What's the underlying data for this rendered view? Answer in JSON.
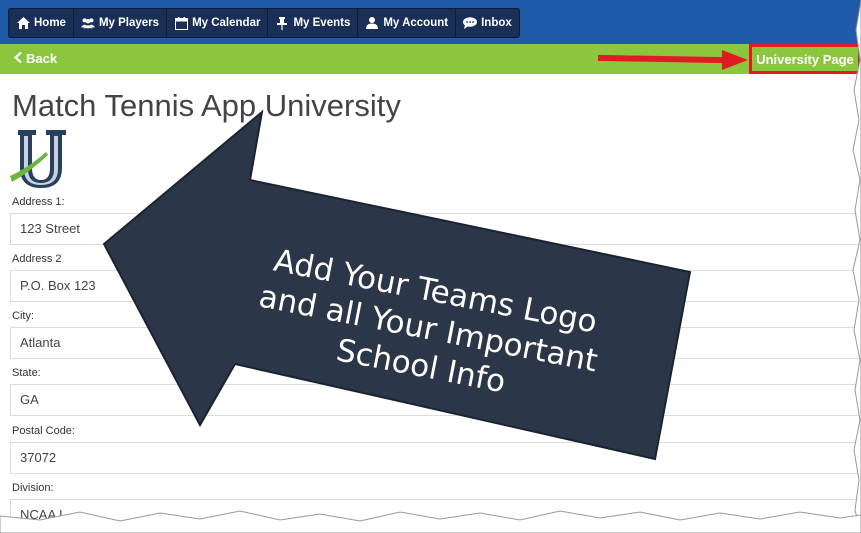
{
  "nav": {
    "items": [
      {
        "label": "Home",
        "icon": "home-icon"
      },
      {
        "label": "My Players",
        "icon": "users-icon"
      },
      {
        "label": "My Calendar",
        "icon": "calendar-icon"
      },
      {
        "label": "My Events",
        "icon": "pin-icon"
      },
      {
        "label": "My Account",
        "icon": "user-icon"
      },
      {
        "label": "Inbox",
        "icon": "chat-icon"
      }
    ]
  },
  "subbar": {
    "back_label": "Back",
    "university_button": "University Page"
  },
  "page": {
    "title": "Match Tennis App University",
    "logo_icon": "university-u-logo"
  },
  "fields": [
    {
      "label": "Address 1:",
      "value": "123 Street"
    },
    {
      "label": "Address 2",
      "value": "P.O. Box 123"
    },
    {
      "label": "City:",
      "value": "Atlanta"
    },
    {
      "label": "State:",
      "value": "GA"
    },
    {
      "label": "Postal Code:",
      "value": "37072"
    },
    {
      "label": "Division:",
      "value": "NCAA I"
    }
  ],
  "callout": {
    "lines": [
      "Add Your Teams Logo",
      "and all Your Important",
      "School Info"
    ]
  },
  "colors": {
    "nav_bg": "#1f5aa8",
    "nav_group": "#1a2f57",
    "green_bar": "#8cc63f",
    "highlight_red": "#e01b24",
    "callout_fill": "#2b3648"
  }
}
